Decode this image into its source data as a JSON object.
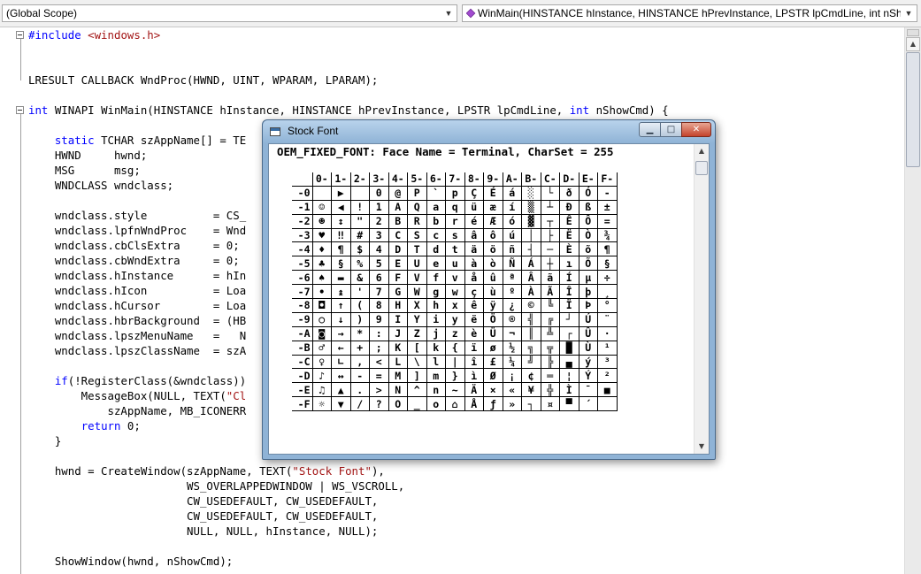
{
  "scope_combo": {
    "value": "(Global Scope)"
  },
  "function_combo": {
    "value": "WinMain(HINSTANCE hInstance, HINSTANCE hPrevInstance, LPSTR lpCmdLine, int nShowCmd)",
    "icon": "function-icon"
  },
  "code": [
    [
      [
        "pp",
        "#include "
      ],
      [
        "str",
        "<windows.h>"
      ]
    ],
    [],
    [],
    [
      [
        "t",
        "LRESULT CALLBACK WndProc(HWND, UINT, WPARAM, LPARAM);"
      ]
    ],
    [],
    [
      [
        "kw",
        "int"
      ],
      [
        "t",
        " WINAPI WinMain(HINSTANCE hInstance, HINSTANCE hPrevInstance, LPSTR lpCmdLine, "
      ],
      [
        "kw",
        "int"
      ],
      [
        "t",
        " nShowCmd) {"
      ]
    ],
    [],
    [
      [
        "t",
        "    "
      ],
      [
        "kw",
        "static"
      ],
      [
        "t",
        " TCHAR szAppName[] = TE"
      ]
    ],
    [
      [
        "t",
        "    HWND     hwnd;"
      ]
    ],
    [
      [
        "t",
        "    MSG      msg;"
      ]
    ],
    [
      [
        "t",
        "    WNDCLASS wndclass;"
      ]
    ],
    [],
    [
      [
        "t",
        "    wndclass.style          = CS_"
      ]
    ],
    [
      [
        "t",
        "    wndclass.lpfnWndProc    = Wnd"
      ]
    ],
    [
      [
        "t",
        "    wndclass.cbClsExtra     = 0;"
      ]
    ],
    [
      [
        "t",
        "    wndclass.cbWndExtra     = 0;"
      ]
    ],
    [
      [
        "t",
        "    wndclass.hInstance      = hIn"
      ]
    ],
    [
      [
        "t",
        "    wndclass.hIcon          = Loa"
      ]
    ],
    [
      [
        "t",
        "    wndclass.hCursor        = Loa"
      ]
    ],
    [
      [
        "t",
        "    wndclass.hbrBackground  = (HB"
      ]
    ],
    [
      [
        "t",
        "    wndclass.lpszMenuName   =   N"
      ]
    ],
    [
      [
        "t",
        "    wndclass.lpszClassName  = szA"
      ]
    ],
    [],
    [
      [
        "t",
        "    "
      ],
      [
        "kw",
        "if"
      ],
      [
        "t",
        "(!RegisterClass(&wndclass))"
      ]
    ],
    [
      [
        "t",
        "        MessageBox(NULL, TEXT("
      ],
      [
        "str",
        "\"Cl"
      ]
    ],
    [
      [
        "t",
        "            szAppName, MB_ICONERR"
      ]
    ],
    [
      [
        "t",
        "        "
      ],
      [
        "kw",
        "return"
      ],
      [
        "t",
        " 0;"
      ]
    ],
    [
      [
        "t",
        "    }"
      ]
    ],
    [],
    [
      [
        "t",
        "    hwnd = CreateWindow(szAppName, TEXT("
      ],
      [
        "str",
        "\"Stock Font\""
      ],
      [
        "t",
        "),"
      ]
    ],
    [
      [
        "t",
        "                        WS_OVERLAPPEDWINDOW | WS_VSCROLL,"
      ]
    ],
    [
      [
        "t",
        "                        CW_USEDEFAULT, CW_USEDEFAULT,"
      ]
    ],
    [
      [
        "t",
        "                        CW_USEDEFAULT, CW_USEDEFAULT,"
      ]
    ],
    [
      [
        "t",
        "                        NULL, NULL, hInstance, NULL);"
      ]
    ],
    [],
    [
      [
        "t",
        "    ShowWindow(hwnd, nShowCmd);"
      ]
    ]
  ],
  "window": {
    "title": "Stock Font",
    "caption": "OEM_FIXED_FONT: Face Name = Terminal, CharSet = 255",
    "buttons": {
      "minimize": "▁",
      "maximize": "□",
      "close": "✕"
    }
  },
  "char_table": {
    "columns": [
      "0-",
      "1-",
      "2-",
      "3-",
      "4-",
      "5-",
      "6-",
      "7-",
      "8-",
      "9-",
      "A-",
      "B-",
      "C-",
      "D-",
      "E-",
      "F-"
    ],
    "rows": [
      {
        "label": "-0",
        "cells": [
          "",
          " ▶",
          "",
          "0",
          "@",
          "P",
          "`",
          "p",
          "Ç",
          "É",
          "á",
          "░",
          "└",
          "ð",
          "Ó",
          "-"
        ]
      },
      {
        "label": "-1",
        "cells": [
          "☺",
          "◀",
          "!",
          "1",
          "A",
          "Q",
          "a",
          "q",
          "ü",
          "æ",
          "í",
          "▒",
          "┴",
          "Ð",
          "ß",
          "±"
        ]
      },
      {
        "label": "-2",
        "cells": [
          "☻",
          "↕",
          "\"",
          "2",
          "B",
          "R",
          "b",
          "r",
          "é",
          "Æ",
          "ó",
          "▓",
          "┬",
          "Ê",
          "Ô",
          "="
        ]
      },
      {
        "label": "-3",
        "cells": [
          "♥",
          "‼",
          "#",
          "3",
          "C",
          "S",
          "c",
          "s",
          "â",
          "ô",
          "ú",
          "│",
          "├",
          "Ë",
          "Ò",
          "¾"
        ]
      },
      {
        "label": "-4",
        "cells": [
          "♦",
          "¶",
          "$",
          "4",
          "D",
          "T",
          "d",
          "t",
          "ä",
          "ö",
          "ñ",
          "┤",
          "─",
          "È",
          "õ",
          "¶"
        ]
      },
      {
        "label": "-5",
        "cells": [
          "♣",
          "§",
          "%",
          "5",
          "E",
          "U",
          "e",
          "u",
          "à",
          "ò",
          "Ñ",
          "Á",
          "┼",
          "ı",
          "Õ",
          "§"
        ]
      },
      {
        "label": "-6",
        "cells": [
          "♠",
          "▬",
          "&",
          "6",
          "F",
          "V",
          "f",
          "v",
          "å",
          "û",
          "ª",
          "Â",
          "ã",
          "Í",
          "µ",
          "÷"
        ]
      },
      {
        "label": "-7",
        "cells": [
          "•",
          "↨",
          "'",
          "7",
          "G",
          "W",
          "g",
          "w",
          "ç",
          "ù",
          "º",
          "À",
          "Ã",
          "Î",
          "þ",
          "¸"
        ]
      },
      {
        "label": "-8",
        "cells": [
          "◘",
          "↑",
          "(",
          "8",
          "H",
          "X",
          "h",
          "x",
          "ê",
          "ÿ",
          "¿",
          "©",
          "╚",
          "Ï",
          "Þ",
          "°"
        ]
      },
      {
        "label": "-9",
        "cells": [
          "○",
          "↓",
          ")",
          "9",
          "I",
          "Y",
          "i",
          "y",
          "ë",
          "Ö",
          "®",
          "╣",
          "╔",
          "┘",
          "Ú",
          "¨"
        ]
      },
      {
        "label": "-A",
        "cells": [
          "◙",
          "→",
          "*",
          ":",
          "J",
          "Z",
          "j",
          "z",
          "è",
          "Ü",
          "¬",
          "║",
          "╩",
          "┌",
          "Û",
          "·"
        ]
      },
      {
        "label": "-B",
        "cells": [
          "♂",
          "←",
          "+",
          ";",
          "K",
          "[",
          "k",
          "{",
          "ï",
          "ø",
          "½",
          "╗",
          "╦",
          "█",
          "Ù",
          "¹"
        ]
      },
      {
        "label": "-C",
        "cells": [
          "♀",
          "∟",
          ",",
          "<",
          "L",
          "\\",
          "l",
          "|",
          "î",
          "£",
          "¼",
          "╝",
          "╠",
          "▄",
          "ý",
          "³"
        ]
      },
      {
        "label": "-D",
        "cells": [
          "♪",
          "↔",
          "-",
          "=",
          "M",
          "]",
          "m",
          "}",
          "ì",
          "Ø",
          "¡",
          "¢",
          "═",
          "¦",
          "Ý",
          "²"
        ]
      },
      {
        "label": "-E",
        "cells": [
          "♫",
          "▲",
          ".",
          ">",
          "N",
          "^",
          "n",
          "~",
          "Ä",
          "×",
          "«",
          "¥",
          "╬",
          "Ì",
          "¯",
          "■"
        ]
      },
      {
        "label": "-F",
        "cells": [
          "☼",
          "▼",
          "/",
          "?",
          "O",
          "_",
          "o",
          "⌂",
          "Å",
          "ƒ",
          "»",
          "┐",
          "¤",
          "▀",
          "´",
          ""
        ]
      }
    ]
  }
}
